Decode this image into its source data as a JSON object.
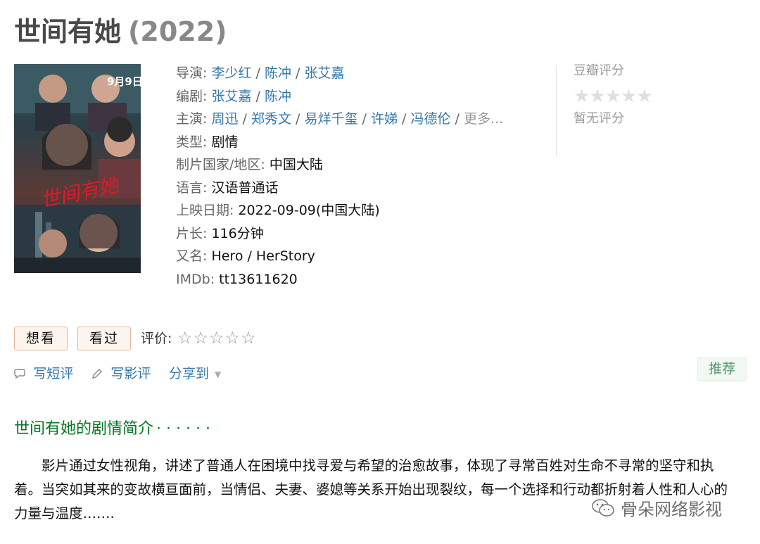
{
  "movie": {
    "title": "世间有她",
    "year": "(2022)"
  },
  "poster": {
    "date_text": "9月9日",
    "calligraphy": "世间有她"
  },
  "info": {
    "director": {
      "label": "导演:",
      "names": [
        "李少红",
        "陈冲",
        "张艾嘉"
      ]
    },
    "writer": {
      "label": "编剧:",
      "names": [
        "张艾嘉",
        "陈冲"
      ]
    },
    "cast": {
      "label": "主演:",
      "names": [
        "周迅",
        "郑秀文",
        "易烊千玺",
        "许娣",
        "冯德伦"
      ],
      "more": "更多..."
    },
    "genre": {
      "label": "类型:",
      "value": "剧情"
    },
    "country": {
      "label": "制片国家/地区:",
      "value": "中国大陆"
    },
    "language": {
      "label": "语言:",
      "value": "汉语普通话"
    },
    "release": {
      "label": "上映日期:",
      "value": "2022-09-09(中国大陆)"
    },
    "runtime": {
      "label": "片长:",
      "value": "116分钟"
    },
    "aka": {
      "label": "又名:",
      "value": "Hero / HerStory"
    },
    "imdb": {
      "label": "IMDb:",
      "value": "tt13611620"
    }
  },
  "rating": {
    "title": "豆瓣评分",
    "stars": "★★★★★",
    "status": "暂无评分"
  },
  "actions": {
    "want": "想看",
    "seen": "看过",
    "rate_label": "评价:",
    "rate_stars": "☆☆☆☆☆",
    "short_review": "写短评",
    "review": "写影评",
    "share": "分享到",
    "recommend": "推荐"
  },
  "synopsis": {
    "title": "世间有她的剧情简介",
    "dots": "· · · · · ·",
    "text": "影片通过女性视角，讲述了普通人在困境中找寻爱与希望的治愈故事，体现了寻常百姓对生命不寻常的坚守和执着。当突如其来的变故横亘面前，当情侣、夫妻、婆媳等关系开始出现裂纹，每一个选择和行动都折射着人性和人心的力量与温度……."
  },
  "watermark": "骨朵网络影视",
  "colors": {
    "link": "#3377aa",
    "green_title": "#007722",
    "button_bg": "#fef6ee",
    "button_border": "#e3b899"
  }
}
